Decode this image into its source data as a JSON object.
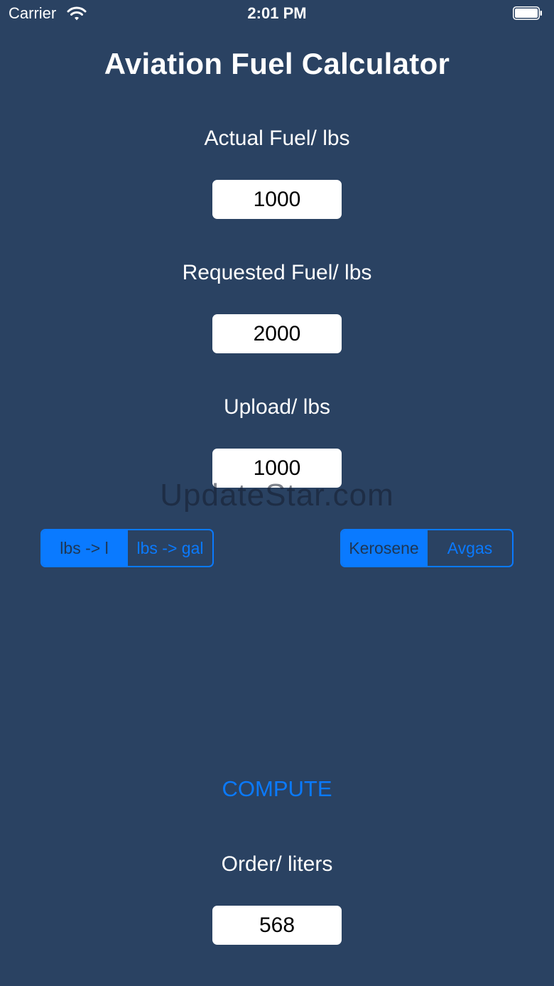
{
  "status_bar": {
    "carrier": "Carrier",
    "time": "2:01 PM",
    "wifi_icon": "wifi-icon",
    "battery_icon": "battery-icon"
  },
  "title": "Aviation Fuel Calculator",
  "fields": {
    "actual_fuel": {
      "label": "Actual Fuel/ lbs",
      "value": "1000"
    },
    "requested_fuel": {
      "label": "Requested Fuel/ lbs",
      "value": "2000"
    },
    "upload": {
      "label": "Upload/ lbs",
      "value": "1000"
    },
    "order": {
      "label": "Order/ liters",
      "value": "568"
    }
  },
  "unit_segment": {
    "options": [
      "lbs -> l",
      "lbs -> gal"
    ],
    "selected": "lbs -> l"
  },
  "fuel_segment": {
    "options": [
      "Kerosene",
      "Avgas"
    ],
    "selected": "Kerosene"
  },
  "compute_label": "COMPUTE",
  "watermark": "UpdateStar.com",
  "colors": {
    "background": "#2a4262",
    "accent": "#0a7aff",
    "field_bg": "#ffffff"
  }
}
